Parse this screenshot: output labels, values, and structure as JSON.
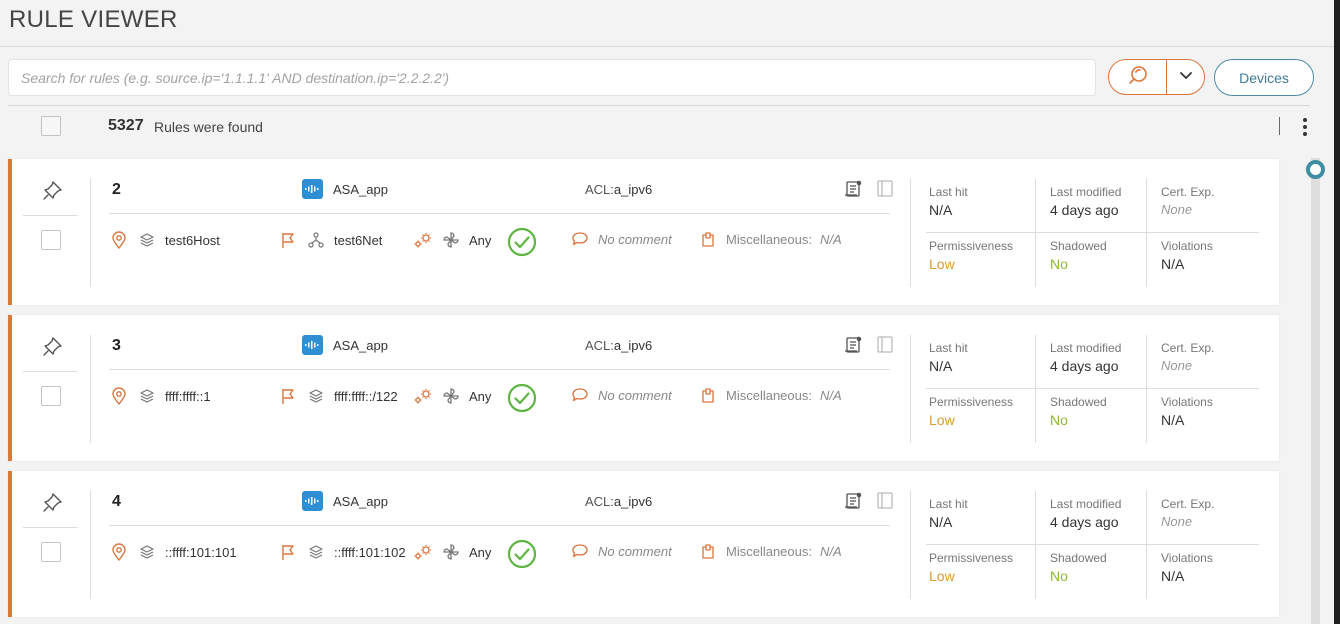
{
  "page": {
    "title": "RULE VIEWER"
  },
  "search": {
    "placeholder": "Search for rules (e.g. source.ip='1.1.1.1' AND destination.ip='2.2.2.2')",
    "value": ""
  },
  "toolbar": {
    "devices_label": "Devices"
  },
  "results": {
    "count": "5327",
    "label": "Rules were found"
  },
  "stat_labels": {
    "last_hit": "Last hit",
    "last_modified": "Last modified",
    "cert_exp": "Cert. Exp.",
    "permissiveness": "Permissiveness",
    "shadowed": "Shadowed",
    "violations": "Violations",
    "misc_label": "Miscellaneous:"
  },
  "colors": {
    "accent": "#d9773f",
    "teal": "#3f8ea3",
    "cisco_blue": "#2e8fd4",
    "allow_green": "#5fb543",
    "low": "#e09a2c",
    "no": "#8fb82e"
  },
  "rules": [
    {
      "number": "2",
      "device": "ASA_app",
      "acl_label": "ACL:",
      "acl_name": "a_ipv6",
      "source": "test6Host",
      "destination": "test6Net",
      "service": "Any",
      "comment": "No comment",
      "misc_value": "N/A",
      "last_hit": "N/A",
      "last_modified": "4 days ago",
      "cert_exp": "None",
      "permissiveness": "Low",
      "shadowed": "No",
      "violations": "N/A"
    },
    {
      "number": "3",
      "device": "ASA_app",
      "acl_label": "ACL:",
      "acl_name": "a_ipv6",
      "source": "ffff:ffff::1",
      "destination": "ffff:ffff::/122",
      "service": "Any",
      "comment": "No comment",
      "misc_value": "N/A",
      "last_hit": "N/A",
      "last_modified": "4 days ago",
      "cert_exp": "None",
      "permissiveness": "Low",
      "shadowed": "No",
      "violations": "N/A"
    },
    {
      "number": "4",
      "device": "ASA_app",
      "acl_label": "ACL:",
      "acl_name": "a_ipv6",
      "source": "::ffff:101:101",
      "destination": "::ffff:101:102",
      "service": "Any",
      "comment": "No comment",
      "misc_value": "N/A",
      "last_hit": "N/A",
      "last_modified": "4 days ago",
      "cert_exp": "None",
      "permissiveness": "Low",
      "shadowed": "No",
      "violations": "N/A"
    }
  ]
}
